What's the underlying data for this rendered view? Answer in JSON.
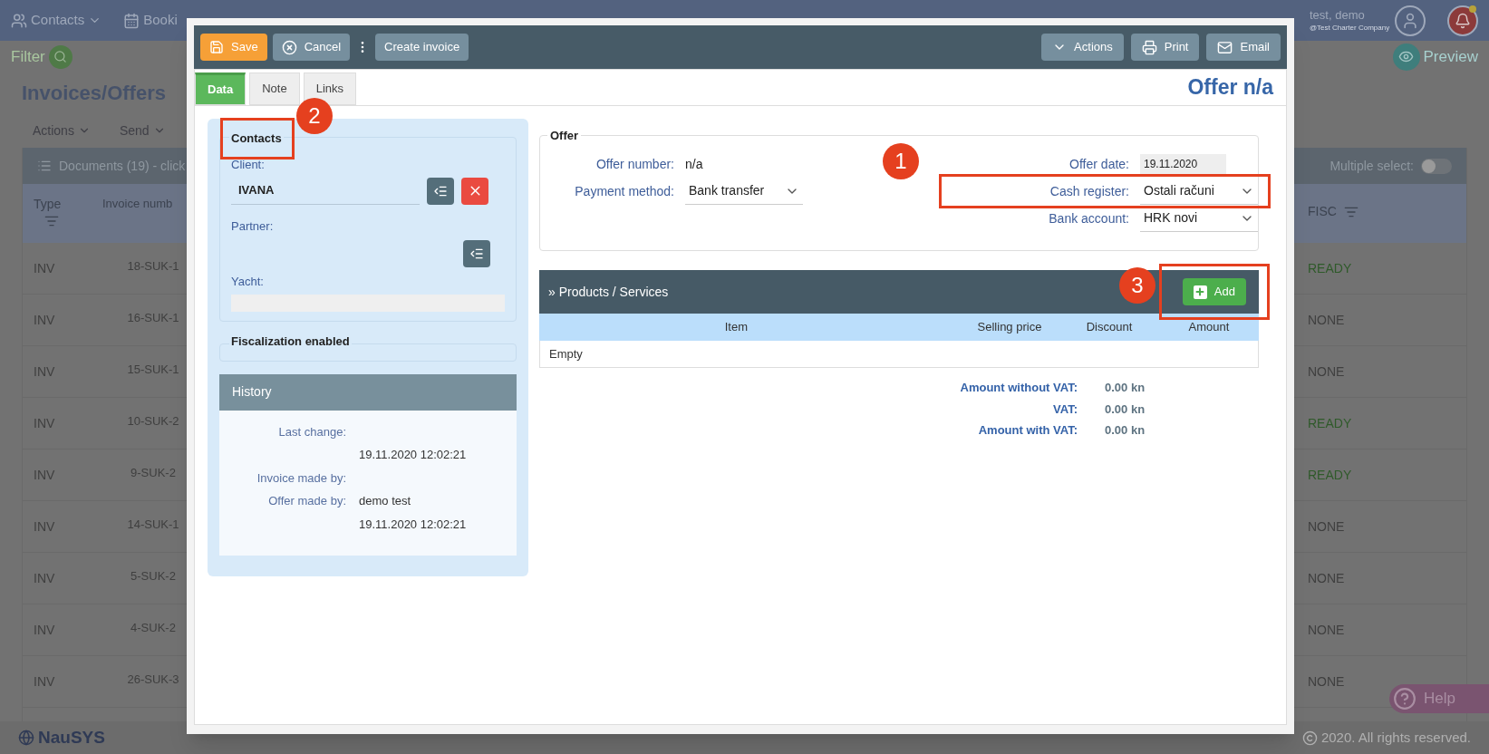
{
  "topbar": {
    "nav": [
      {
        "label": "Contacts"
      },
      {
        "label": "Booki"
      }
    ],
    "user_name": "test, demo",
    "company": "@Test Charter Company"
  },
  "filter_label": "Filter",
  "preview_label": "Preview",
  "page_title": "Invoices/Offers",
  "page_actions": [
    "Actions",
    "Send"
  ],
  "documents_bar": {
    "title": "Documents (19) - click",
    "multiple_select_label": "Multiple select:",
    "multiple_select_on": false
  },
  "table": {
    "columns": [
      "Type",
      "Invoice numb",
      "FISC"
    ],
    "rows": [
      {
        "type": "INV",
        "number": "18-SUK-1",
        "fisc": "READY",
        "color": "#2f5a2a"
      },
      {
        "type": "INV",
        "number": "16-SUK-1",
        "fisc": "NONE",
        "color": "#3f3f3f"
      },
      {
        "type": "INV",
        "number": "15-SUK-1",
        "fisc": "NONE",
        "color": "#3f3f3f"
      },
      {
        "type": "INV",
        "number": "10-SUK-2",
        "fisc": "READY",
        "color": "#2f5a2a"
      },
      {
        "type": "INV",
        "number": "9-SUK-2",
        "fisc": "READY",
        "color": "#2f5a2a"
      },
      {
        "type": "INV",
        "number": "14-SUK-1",
        "fisc": "NONE",
        "color": "#3f3f3f"
      },
      {
        "type": "INV",
        "number": "5-SUK-2",
        "fisc": "NONE",
        "color": "#3f3f3f"
      },
      {
        "type": "INV",
        "number": "4-SUK-2",
        "fisc": "NONE",
        "color": "#3f3f3f"
      },
      {
        "type": "INV",
        "number": "26-SUK-3",
        "fisc": "NONE",
        "color": "#3f3f3f"
      }
    ]
  },
  "help_label": "Help",
  "footer": {
    "logo": "NauSYS",
    "copyright": "2020. All rights reserved."
  },
  "modal": {
    "left_buttons": [
      {
        "label": "Save",
        "kind": "primary"
      },
      {
        "label": "Cancel",
        "kind": "cancel"
      },
      {
        "label": "Create invoice",
        "kind": "plain"
      }
    ],
    "right_buttons": [
      {
        "label": "Actions",
        "kind": "dropdown"
      },
      {
        "label": "Print",
        "kind": "print"
      },
      {
        "label": "Email",
        "kind": "email"
      }
    ],
    "tabs": [
      {
        "label": "Data",
        "selected": true
      },
      {
        "label": "Note",
        "selected": false
      },
      {
        "label": "Links",
        "selected": false
      }
    ],
    "title": "Offer n/a",
    "contacts": {
      "legend": "Contacts",
      "annotation": "2",
      "client_label": "Client:",
      "client_value": "IVANA",
      "partner_label": "Partner:",
      "yacht_label": "Yacht:"
    },
    "fiscalization_legend": "Fiscalization enabled",
    "history": {
      "title": "History",
      "entries": [
        {
          "label": "Last change:"
        },
        {
          "value": "19.11.2020 12:02:21"
        },
        {
          "label": "Invoice made by:"
        },
        {
          "label": "Offer made by:",
          "value": "demo test"
        },
        {
          "value": "19.11.2020 12:02:21"
        }
      ]
    },
    "offer": {
      "legend": "Offer",
      "left_fields": [
        {
          "label": "Offer number:",
          "value": "n/a",
          "kind": "text"
        },
        {
          "label": "Payment method:",
          "value": "Bank transfer",
          "kind": "select"
        }
      ],
      "right_fields": [
        {
          "label": "Offer date:",
          "value": "19.11.2020",
          "kind": "date"
        },
        {
          "label": "Cash register:",
          "value": "Ostali računi",
          "kind": "select",
          "annotation": "1"
        },
        {
          "label": "Bank account:",
          "value": "HRK novi",
          "kind": "select"
        }
      ]
    },
    "products": {
      "title": "» Products / Services",
      "add_label": "Add",
      "add_annotation": "3",
      "columns": [
        "Item",
        "Selling price",
        "Discount",
        "Amount"
      ],
      "empty_text": "Empty"
    },
    "totals": [
      {
        "label": "Amount without VAT:",
        "value": "0.00 kn"
      },
      {
        "label": "VAT:",
        "value": "0.00 kn"
      },
      {
        "label": "Amount with VAT:",
        "value": "0.00 kn"
      }
    ]
  }
}
